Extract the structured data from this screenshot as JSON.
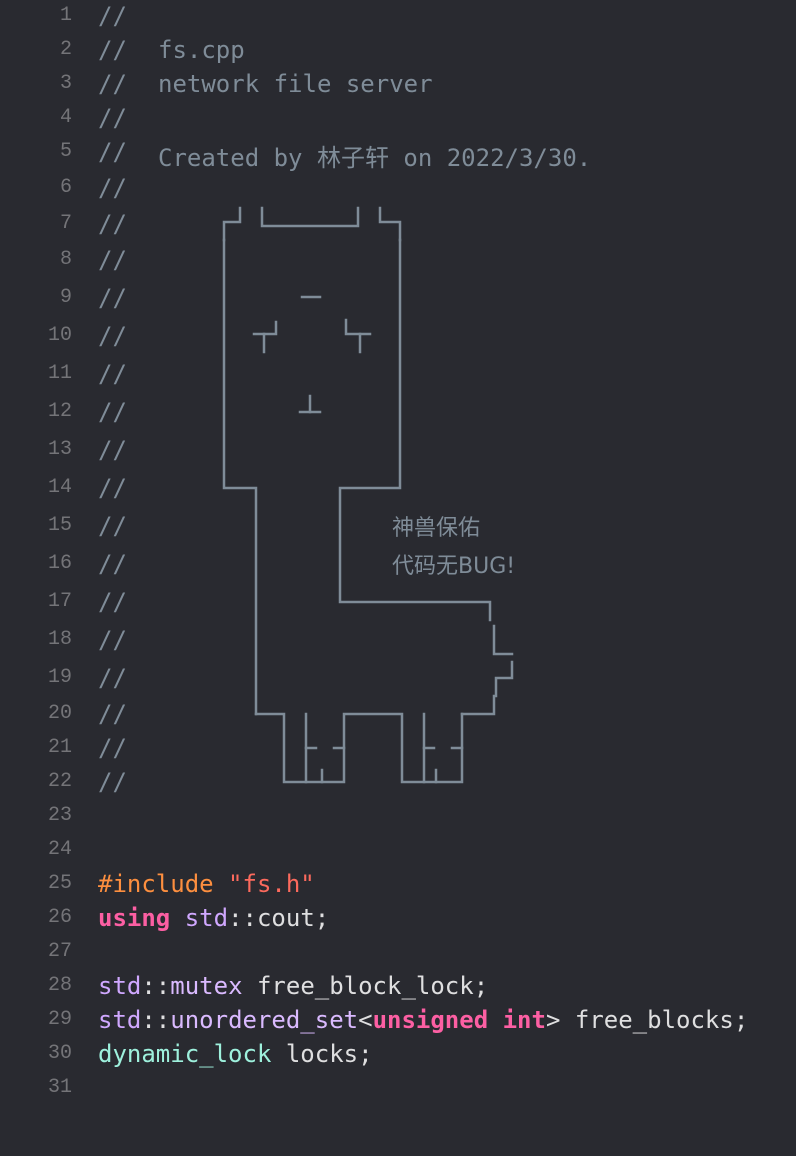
{
  "editor": {
    "language": "C++",
    "line_numbers": [
      "1",
      "2",
      "3",
      "4",
      "5",
      "6",
      "7",
      "8",
      "9",
      "10",
      "11",
      "12",
      "13",
      "14",
      "15",
      "16",
      "17",
      "18",
      "19",
      "20",
      "21",
      "22",
      "23",
      "24",
      "25",
      "26",
      "27",
      "28",
      "29",
      "30",
      "31"
    ],
    "comment_marker": "//",
    "header_comment": {
      "filename": "fs.cpp",
      "description": "network file server",
      "created_by": "Created by 林子轩 on 2022/3/30."
    },
    "ascii_art": {
      "icon": "alpaca-ascii-art",
      "blessing_line1": "神兽保佑",
      "blessing_line2": "代码无BUG!"
    },
    "code": {
      "line25": {
        "directive": "#include",
        "path": "\"fs.h\""
      },
      "line26": {
        "keyword": "using",
        "ns": "std",
        "sep": "::",
        "name": "cout",
        "end": ";"
      },
      "line28": {
        "ns": "std",
        "sep": "::",
        "type": "mutex",
        "var": " free_block_lock;"
      },
      "line29": {
        "ns": "std",
        "sep": "::",
        "type": "unordered_set",
        "lt": "<",
        "kw1": "unsigned",
        "kw2": "int",
        "gt": ">",
        "var": " free_blocks;"
      },
      "line30": {
        "type": "dynamic_lock",
        "var": " locks;"
      }
    },
    "colors": {
      "background": "#292a30",
      "line_number": "#747478",
      "comment": "#7f8c98",
      "preprocessor": "#fd8f3f",
      "string": "#fc6a5d",
      "keyword": "#fc5fa3",
      "type": "#d0a8ff",
      "project_type": "#9ef1dd",
      "plain_text": "#dfdfe0"
    }
  }
}
